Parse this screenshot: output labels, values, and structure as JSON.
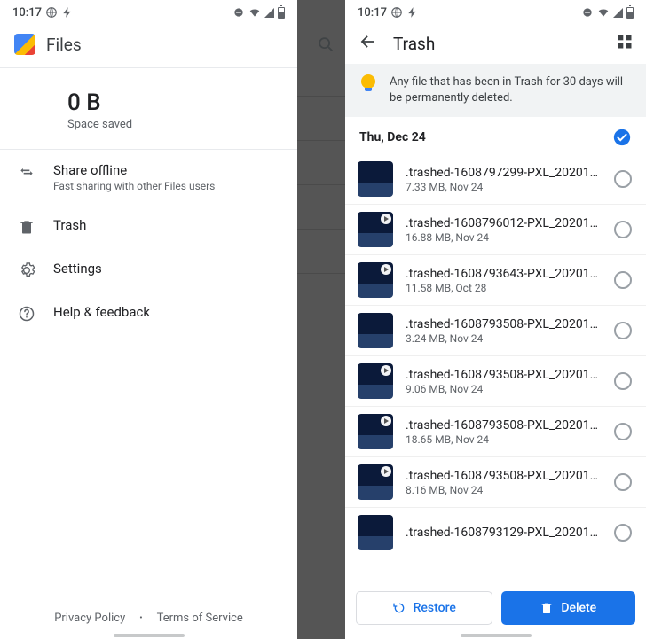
{
  "status": {
    "time": "10:17"
  },
  "left": {
    "app_name": "Files",
    "space_value": "0 B",
    "space_label": "Space saved",
    "menu": [
      {
        "icon": "swap",
        "title": "Share offline",
        "sub": "Fast sharing with other Files users"
      },
      {
        "icon": "trash",
        "title": "Trash"
      },
      {
        "icon": "gear",
        "title": "Settings"
      },
      {
        "icon": "help",
        "title": "Help & feedback"
      }
    ],
    "footer": {
      "privacy": "Privacy Policy",
      "tos": "Terms of Service"
    }
  },
  "right": {
    "title": "Trash",
    "banner": "Any file that has been in Trash for 30 days will be permanently deleted.",
    "section_date": "Thu, Dec 24",
    "items": [
      {
        "name": ".trashed-1608797299-PXL_20201…",
        "size": "7.33 MB",
        "date": "Nov 24",
        "play": false
      },
      {
        "name": ".trashed-1608796012-PXL_20201…",
        "size": "16.88 MB",
        "date": "Nov 24",
        "play": true
      },
      {
        "name": ".trashed-1608793643-PXL_20201…",
        "size": "11.58 MB",
        "date": "Oct 28",
        "play": true
      },
      {
        "name": ".trashed-1608793508-PXL_20201…",
        "size": "3.24 MB",
        "date": "Nov 24",
        "play": false
      },
      {
        "name": ".trashed-1608793508-PXL_20201…",
        "size": "9.06 MB",
        "date": "Nov 24",
        "play": true
      },
      {
        "name": ".trashed-1608793508-PXL_20201…",
        "size": "18.65 MB",
        "date": "Nov 24",
        "play": true
      },
      {
        "name": ".trashed-1608793508-PXL_20201…",
        "size": "8.16 MB",
        "date": "Nov 24",
        "play": true
      },
      {
        "name": ".trashed-1608793129-PXL_20201…",
        "size": "",
        "date": "",
        "play": false
      }
    ],
    "restore_label": "Restore",
    "delete_label": "Delete"
  }
}
